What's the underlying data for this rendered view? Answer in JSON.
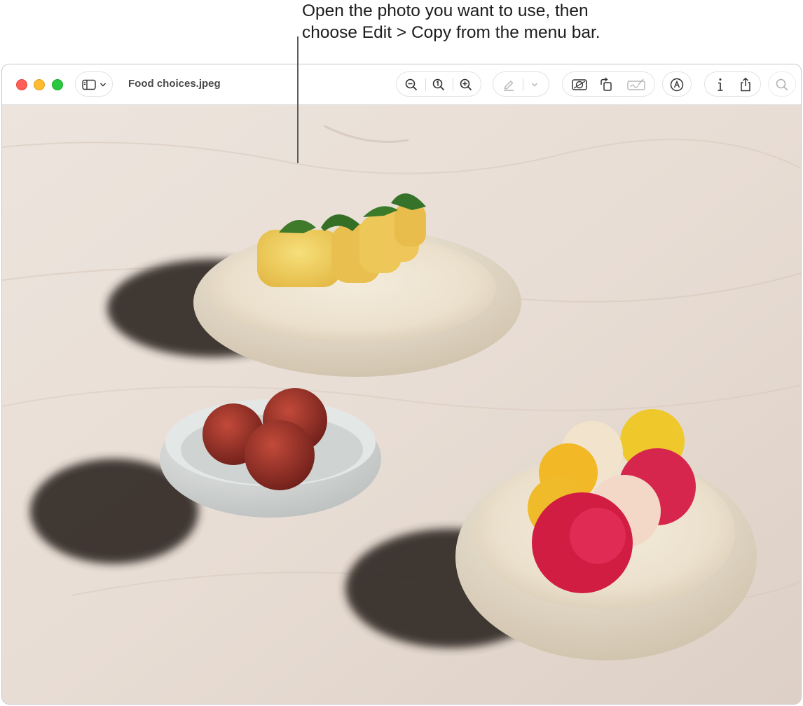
{
  "callout": {
    "line1": "Open the photo you want to use, then",
    "line2": "choose Edit > Copy from the menu bar."
  },
  "window": {
    "title": "Food choices.jpeg",
    "traffic_lights": [
      "close",
      "minimize",
      "zoom"
    ],
    "toolbar": {
      "sidebar_toggle": "sidebar-icon",
      "zoom_group": [
        "zoom-out-icon",
        "actual-size-icon",
        "zoom-in-icon"
      ],
      "highlight_group": [
        "highlight-pen-icon",
        "chevron-down-icon"
      ],
      "edit_group": [
        "adjust-color-icon",
        "rotate-icon",
        "signature-icon"
      ],
      "markup": "markup-icon",
      "info_share_group": [
        "inspector-icon",
        "share-icon"
      ],
      "search": "search-icon"
    }
  },
  "photo": {
    "description_icon": "food-photo"
  },
  "colors": {
    "close": "#ff5f57",
    "minimize": "#febc2e",
    "zoom": "#28c840",
    "counter": "#e7dcd4"
  }
}
